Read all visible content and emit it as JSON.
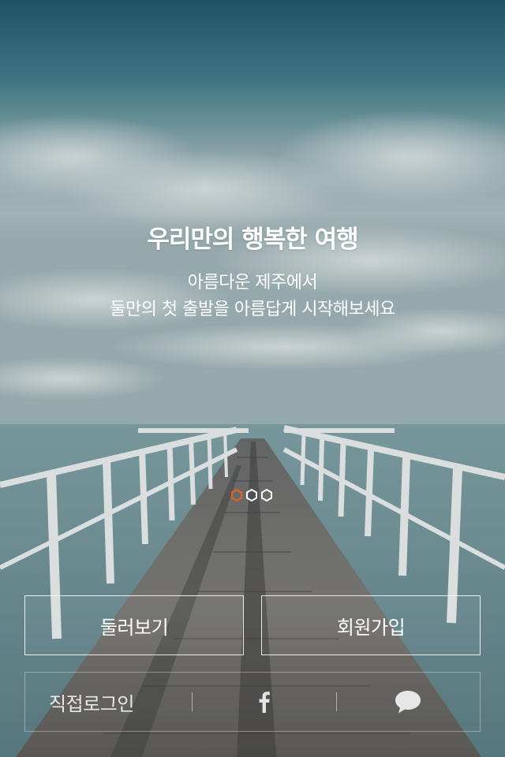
{
  "hero": {
    "title": "우리만의 행복한 여행",
    "subtitle_line1": "아름다운 제주에서",
    "subtitle_line2": "둘만의 첫 출발을 아름답게 시작해보세요"
  },
  "carousel": {
    "page_count": 3,
    "active_index": 0,
    "active_color": "#e8622c"
  },
  "buttons": {
    "browse_label": "둘러보기",
    "signup_label": "회원가입"
  },
  "login_bar": {
    "direct_login_label": "직접로그인",
    "facebook_icon": "facebook-icon",
    "kakaotalk_icon": "speech-bubble-icon"
  }
}
